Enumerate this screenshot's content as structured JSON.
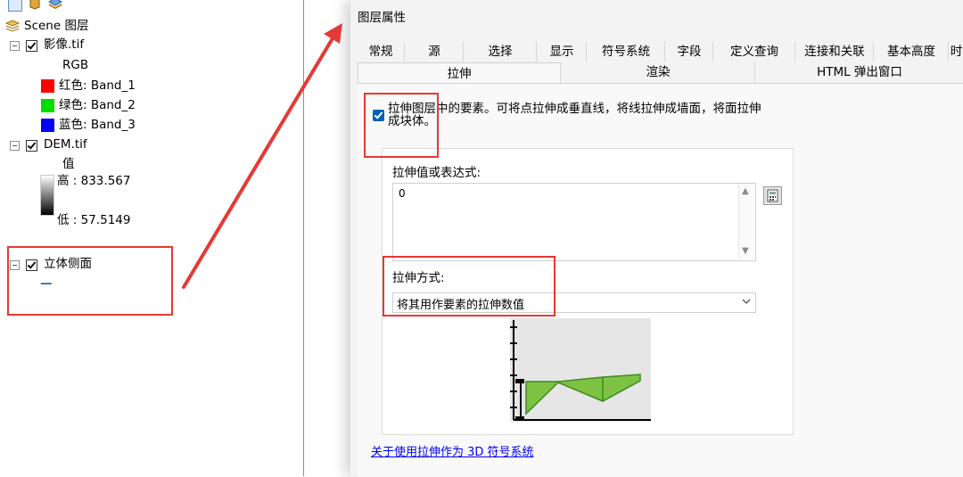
{
  "toc": {
    "root_label": "Scene 图层",
    "layers": [
      {
        "name": "影像.tif",
        "checked": true,
        "legend": {
          "header": "RGB",
          "bands": [
            {
              "label": "红色:   Band_1",
              "color": "#ff0000"
            },
            {
              "label": "绿色: Band_2",
              "color": "#00dd00"
            },
            {
              "label": "蓝色:   Band_3",
              "color": "#0000ff"
            }
          ]
        }
      },
      {
        "name": "DEM.tif",
        "checked": true,
        "legend": {
          "header": "值",
          "high": "高 : 833.567",
          "low": "低 : 57.5149"
        }
      },
      {
        "name": "立体侧面",
        "checked": true,
        "legend": {
          "symbol": "—",
          "symbol_color": "#1565c0"
        }
      }
    ]
  },
  "dialog": {
    "title": "图层属性",
    "tabs_row1": [
      "常规",
      "源",
      "选择",
      "显示",
      "符号系统",
      "字段",
      "定义查询",
      "连接和关联",
      "基本高度",
      "时"
    ],
    "tabs_row2": [
      "拉伸",
      "渲染",
      "HTML 弹出窗口"
    ],
    "active_tab": "拉伸",
    "extrude_checkbox": {
      "checked": true,
      "label_line1": "拉伸图层中的要素。可将点拉伸成垂直线，将线拉伸成墙面，将面拉伸",
      "label_line2": "成块体。"
    },
    "expression_label": "拉伸值或表达式:",
    "expression_value": "0",
    "method_label": "拉伸方式:",
    "method_value": "将其用作要素的拉伸数值",
    "help_link": "关于使用拉伸作为 3D 符号系统"
  },
  "colors": {
    "annotation": "#e53935",
    "extrusion_fill": "#7dc242",
    "link": "#0000ee",
    "accent": "#005fb8"
  }
}
